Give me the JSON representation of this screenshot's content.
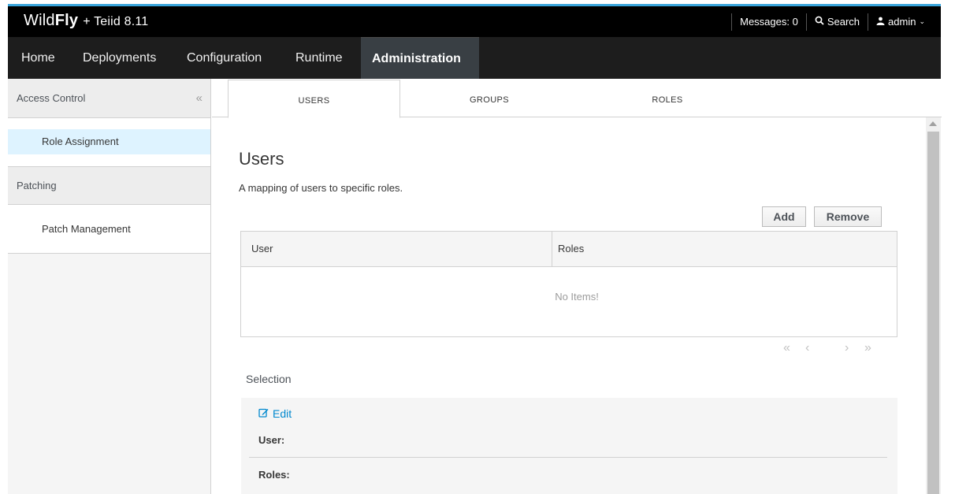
{
  "header": {
    "brand_wild": "Wild",
    "brand_fly": "Fly",
    "brand_suffix": "+ Teiid 8.11",
    "messages": "Messages: 0",
    "search": "Search",
    "user": "admin"
  },
  "nav": {
    "items": [
      {
        "label": "Home"
      },
      {
        "label": "Deployments"
      },
      {
        "label": "Configuration"
      },
      {
        "label": "Runtime"
      },
      {
        "label": "Administration",
        "active": true
      }
    ]
  },
  "sidebar": {
    "access_control": "Access Control",
    "collapse": "«",
    "role_assignment": "Role Assignment",
    "patching": "Patching",
    "patch_management": "Patch Management"
  },
  "tabs": [
    {
      "label": "USERS",
      "active": true
    },
    {
      "label": "GROUPS"
    },
    {
      "label": "ROLES"
    }
  ],
  "main": {
    "title": "Users",
    "description": "A mapping of users to specific roles.",
    "add_label": "Add",
    "remove_label": "Remove",
    "columns": [
      "User",
      "Roles"
    ],
    "empty_text": "No Items!",
    "pager": {
      "first": "«",
      "prev": "‹",
      "next": "›",
      "last": "»"
    },
    "selection_title": "Selection",
    "edit_label": "Edit",
    "user_label": "User:",
    "roles_label": "Roles:"
  },
  "colors": {
    "accent": "#39a5dc",
    "link": "#0088ce",
    "active_nav": "#393f44",
    "active_side": "#def3ff"
  }
}
